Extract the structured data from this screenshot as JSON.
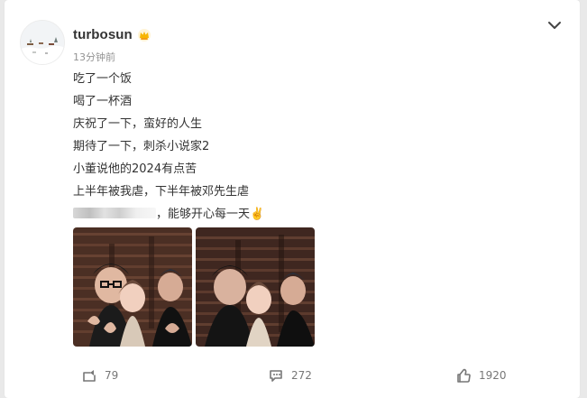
{
  "post": {
    "username": "turbosun",
    "timestamp": "13分钟前",
    "lines": [
      "吃了一个饭",
      "喝了一杯酒",
      "庆祝了一下，蛮好的人生",
      "期待了一下，刺杀小说家2",
      "小董说他的2024有点苦",
      "上半年被我虐，下半年被邓先生虐"
    ],
    "line7_suffix": "，能够开心每一天✌️",
    "photos": [
      {
        "name": "photo-1"
      },
      {
        "name": "photo-2"
      }
    ]
  },
  "actions": {
    "repost_count": "79",
    "comment_count": "272",
    "like_count": "1920"
  },
  "colors": {
    "accent": "#f7b500",
    "text": "#333333",
    "muted": "#939393"
  },
  "icons": {
    "menu": "chevron-down-icon",
    "badge": "crown-icon",
    "repost": "share-icon",
    "comment": "comment-icon",
    "like": "thumbs-up-icon"
  }
}
